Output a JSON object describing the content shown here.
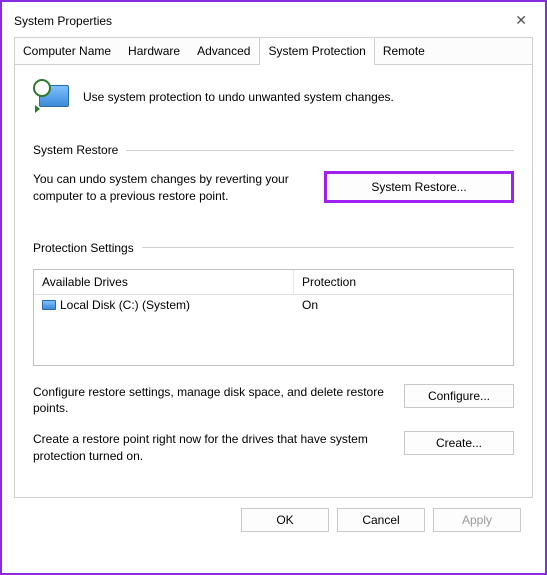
{
  "window": {
    "title": "System Properties"
  },
  "tabs": {
    "computer_name": "Computer Name",
    "hardware": "Hardware",
    "advanced": "Advanced",
    "system_protection": "System Protection",
    "remote": "Remote"
  },
  "panel": {
    "intro": "Use system protection to undo unwanted system changes.",
    "system_restore_heading": "System Restore",
    "system_restore_text": "You can undo system changes by reverting your computer to a previous restore point.",
    "system_restore_button": "System Restore...",
    "protection_settings_heading": "Protection Settings",
    "drives_header_col1": "Available Drives",
    "drives_header_col2": "Protection",
    "drives": [
      {
        "name": "Local Disk (C:) (System)",
        "protection": "On"
      }
    ],
    "configure_text": "Configure restore settings, manage disk space, and delete restore points.",
    "configure_button": "Configure...",
    "create_text": "Create a restore point right now for the drives that have system protection turned on.",
    "create_button": "Create..."
  },
  "dialog_buttons": {
    "ok": "OK",
    "cancel": "Cancel",
    "apply": "Apply"
  }
}
